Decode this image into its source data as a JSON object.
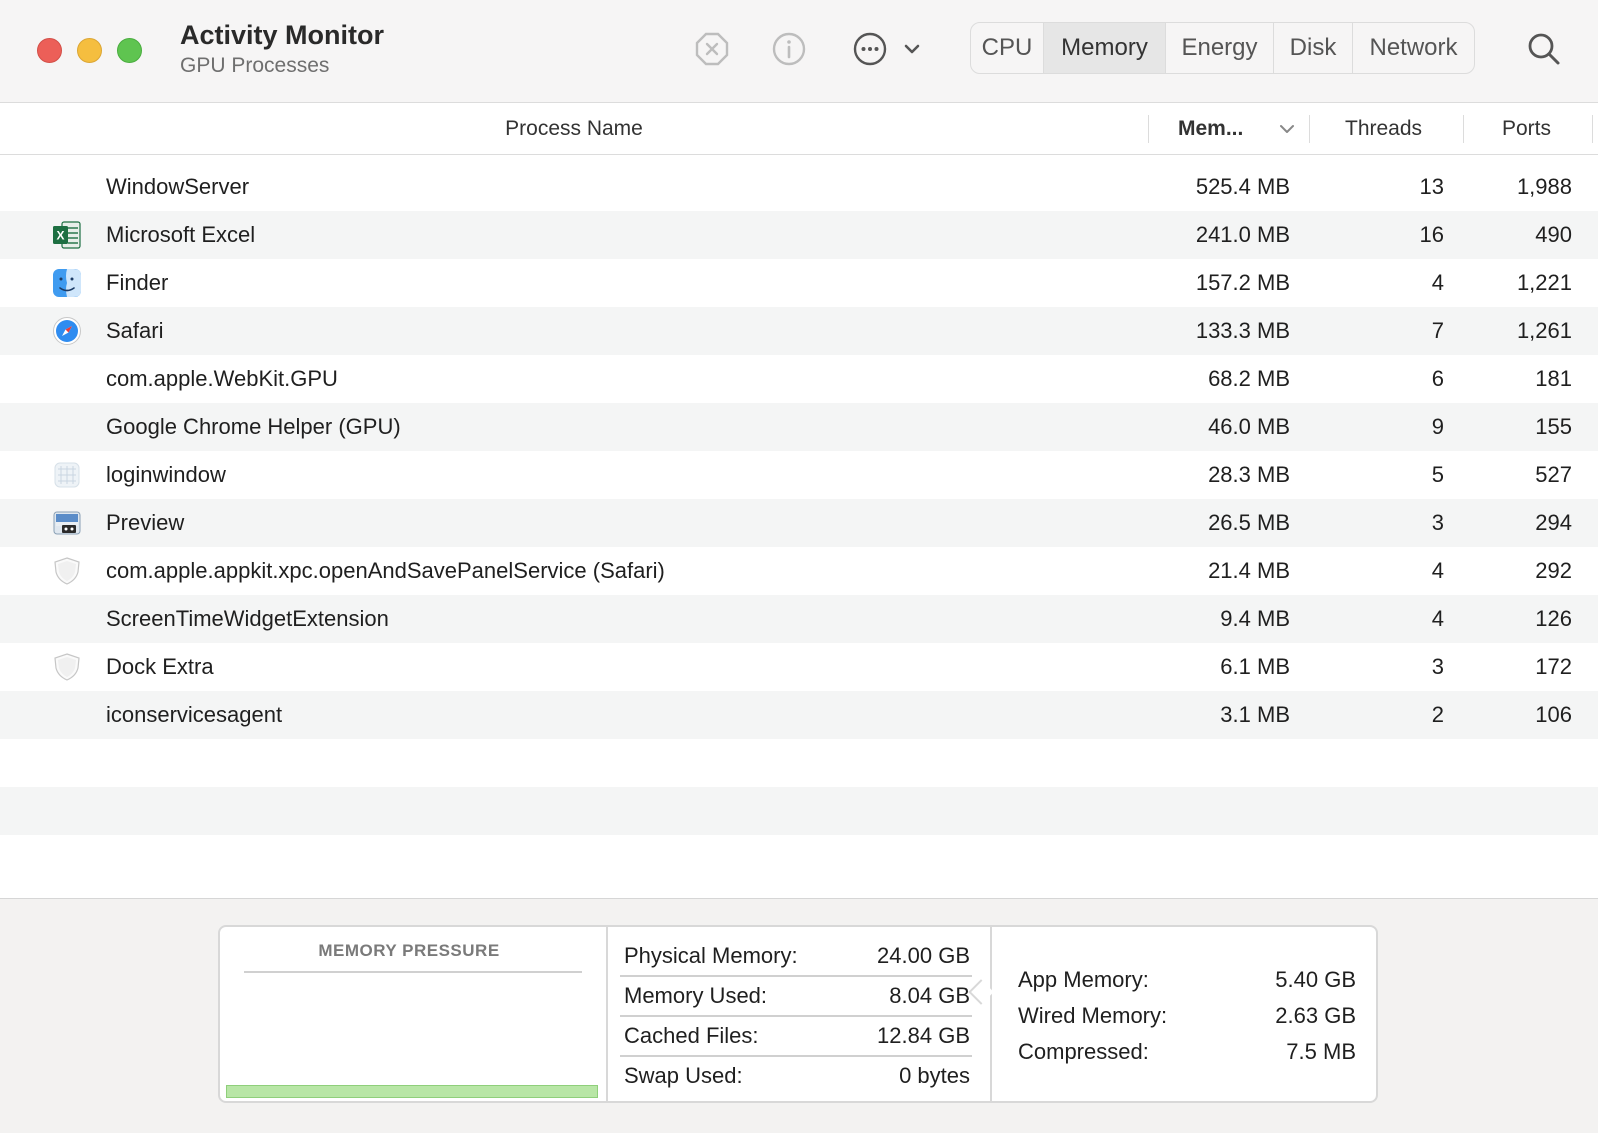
{
  "window": {
    "title": "Activity Monitor",
    "subtitle": "GPU Processes"
  },
  "toolbar": {
    "icons": [
      "stop-process-icon",
      "info-icon",
      "more-actions-icon",
      "chevron-down-icon",
      "search-icon"
    ],
    "tabs": [
      {
        "label": "CPU",
        "active": false
      },
      {
        "label": "Memory",
        "active": true
      },
      {
        "label": "Energy",
        "active": false
      },
      {
        "label": "Disk",
        "active": false
      },
      {
        "label": "Network",
        "active": false
      }
    ]
  },
  "table": {
    "headers": {
      "name": "Process Name",
      "memory": "Mem...",
      "threads": "Threads",
      "ports": "Ports"
    },
    "sort_indicator": "chevron-down-icon",
    "rows": [
      {
        "name": "WindowServer",
        "memory": "525.4 MB",
        "threads": "13",
        "ports": "1,988",
        "icon": ""
      },
      {
        "name": "Microsoft Excel",
        "memory": "241.0 MB",
        "threads": "16",
        "ports": "490",
        "icon": "excel-icon"
      },
      {
        "name": "Finder",
        "memory": "157.2 MB",
        "threads": "4",
        "ports": "1,221",
        "icon": "finder-icon"
      },
      {
        "name": "Safari",
        "memory": "133.3 MB",
        "threads": "7",
        "ports": "1,261",
        "icon": "safari-icon"
      },
      {
        "name": "com.apple.WebKit.GPU",
        "memory": "68.2 MB",
        "threads": "6",
        "ports": "181",
        "icon": ""
      },
      {
        "name": "Google Chrome Helper (GPU)",
        "memory": "46.0 MB",
        "threads": "9",
        "ports": "155",
        "icon": ""
      },
      {
        "name": "loginwindow",
        "memory": "28.3 MB",
        "threads": "5",
        "ports": "527",
        "icon": "loginwindow-icon"
      },
      {
        "name": "Preview",
        "memory": "26.5 MB",
        "threads": "3",
        "ports": "294",
        "icon": "preview-icon"
      },
      {
        "name": "com.apple.appkit.xpc.openAndSavePanelService (Safari)",
        "memory": "21.4 MB",
        "threads": "4",
        "ports": "292",
        "icon": "shield-icon"
      },
      {
        "name": "ScreenTimeWidgetExtension",
        "memory": "9.4 MB",
        "threads": "4",
        "ports": "126",
        "icon": ""
      },
      {
        "name": "Dock Extra",
        "memory": "6.1 MB",
        "threads": "3",
        "ports": "172",
        "icon": "shield-icon"
      },
      {
        "name": "iconservicesagent",
        "memory": "3.1 MB",
        "threads": "2",
        "ports": "106",
        "icon": ""
      }
    ]
  },
  "footer": {
    "memory_pressure_title": "MEMORY PRESSURE",
    "memory_pressure_color": "#b8e6a6",
    "stats_left": [
      {
        "label": "Physical Memory:",
        "value": "24.00 GB"
      },
      {
        "label": "Memory Used:",
        "value": "8.04 GB"
      },
      {
        "label": "Cached Files:",
        "value": "12.84 GB"
      },
      {
        "label": "Swap Used:",
        "value": "0 bytes"
      }
    ],
    "stats_right": [
      {
        "label": "App Memory:",
        "value": "5.40 GB"
      },
      {
        "label": "Wired Memory:",
        "value": "2.63 GB"
      },
      {
        "label": "Compressed:",
        "value": "7.5 MB"
      }
    ]
  }
}
